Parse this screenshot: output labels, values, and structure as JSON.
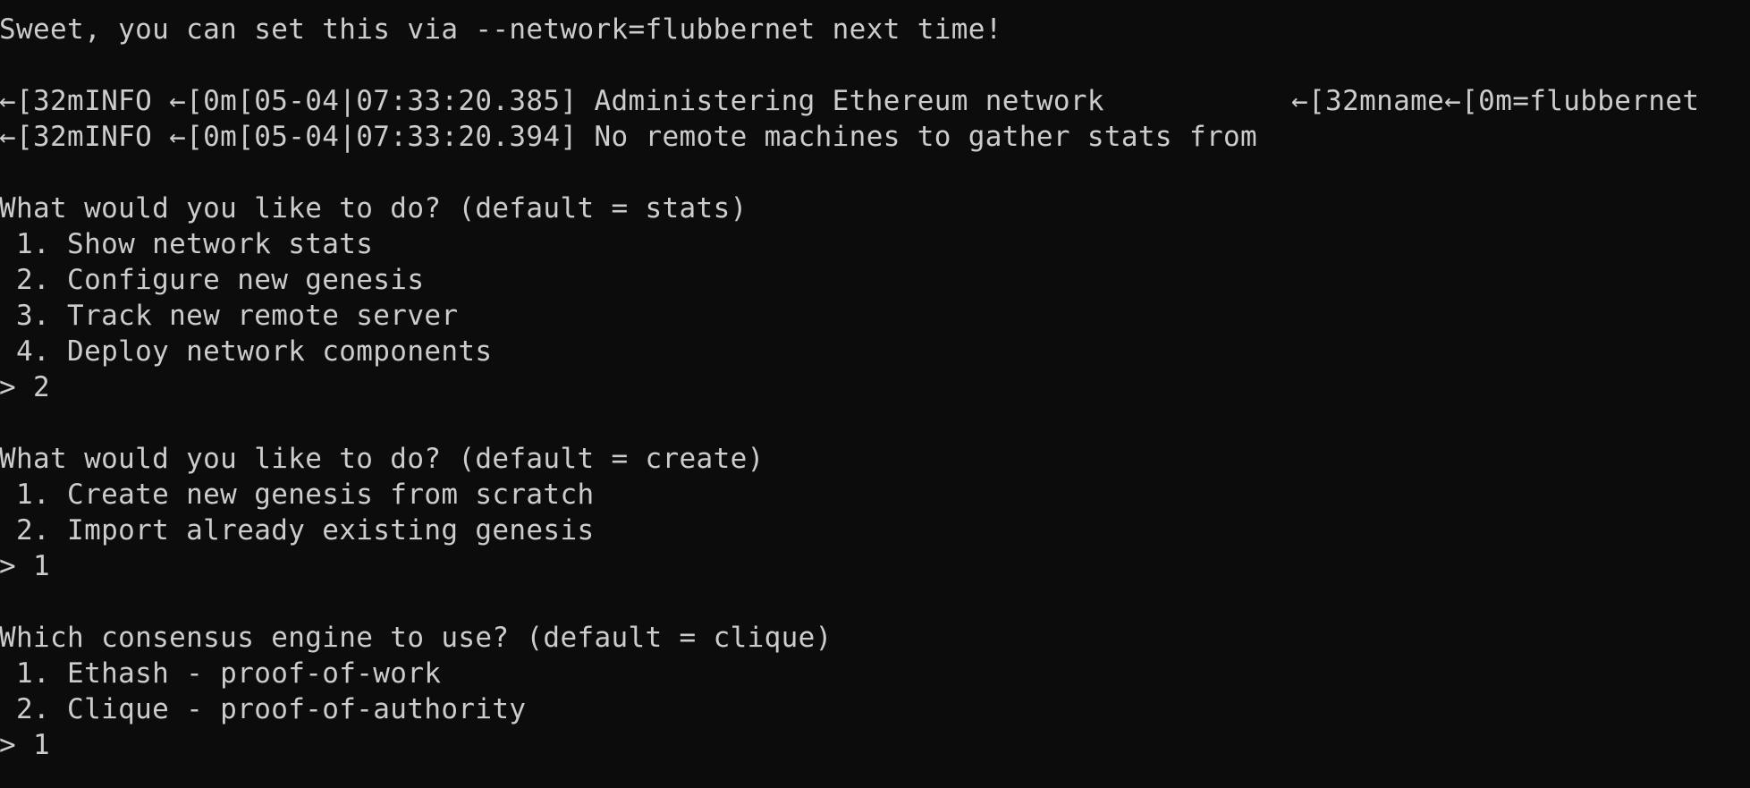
{
  "terminal": {
    "lines": [
      "Sweet, you can set this via --network=flubbernet next time!",
      "",
      "←[32mINFO ←[0m[05-04|07:33:20.385] Administering Ethereum network           ←[32mname←[0m=flubbernet",
      "←[32mINFO ←[0m[05-04|07:33:20.394] No remote machines to gather stats from",
      "",
      "What would you like to do? (default = stats)",
      " 1. Show network stats",
      " 2. Configure new genesis",
      " 3. Track new remote server",
      " 4. Deploy network components",
      "> 2",
      "",
      "What would you like to do? (default = create)",
      " 1. Create new genesis from scratch",
      " 2. Import already existing genesis",
      "> 1",
      "",
      "Which consensus engine to use? (default = clique)",
      " 1. Ethash - proof-of-work",
      " 2. Clique - proof-of-authority",
      "> 1"
    ]
  },
  "colors": {
    "background": "#0c0c0c",
    "foreground": "#cccccc"
  }
}
